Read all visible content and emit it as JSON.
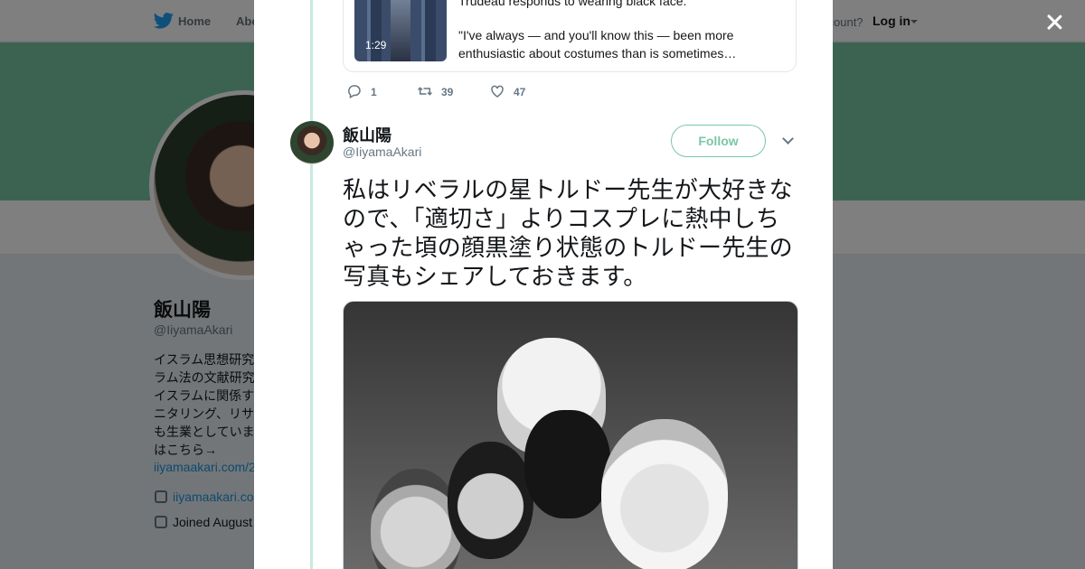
{
  "nav": {
    "home_label": "Home",
    "about_label": "Abo",
    "account_prompt": "ccount?",
    "login_label": "Log in"
  },
  "profile": {
    "name": "飯山陽",
    "handle": "@IiyamaAkari",
    "bio_lines": [
      "イスラム思想研究",
      "ラム法の文献研究",
      "イスラムに関係す",
      "ニタリング、リサ",
      "も生業としていま",
      "はこちら→"
    ],
    "bio_link": "iiyamaakari.com/2",
    "website": "iiyamaakari.co",
    "joined": "Joined August"
  },
  "modal": {
    "close_label": "×",
    "video_card": {
      "title": "Trudeau responds to wearing black face.",
      "duration": "1:29",
      "description": "\"I've always — and you'll know this — been more enthusiastic about costumes than is sometimes…"
    },
    "actions": {
      "replies": "1",
      "retweets": "39",
      "likes": "47"
    },
    "tweet": {
      "author_name": "飯山陽",
      "author_handle": "@IiyamaAkari",
      "follow_label": "Follow",
      "text": "私はリベラルの星トルドー先生が大好きなので、「適切さ」よりコスプレに熱中しちゃった頃の顔黒塗り状態のトルドー先生の写真もシェアしておきます。"
    }
  },
  "colors": {
    "accent": "#79c7a5",
    "thread_line": "#c8ebdb",
    "link": "#1b95e0",
    "muted_text": "#657786"
  }
}
